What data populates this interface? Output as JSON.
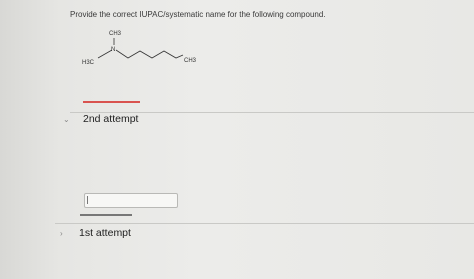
{
  "question": {
    "prompt": "Provide the correct IUPAC/systematic name for the following compound."
  },
  "structure": {
    "label_top_methyl": "CH3",
    "label_nitrogen": "N",
    "label_left_methyl": "H3C",
    "label_chain_end": "CH3"
  },
  "attempts": [
    {
      "label": "2nd attempt",
      "expanded": true,
      "chevron_icon": "chevron-down-icon"
    },
    {
      "label": "1st attempt",
      "expanded": false,
      "chevron_icon": "chevron-right-icon"
    }
  ],
  "answer_input": {
    "value": "",
    "placeholder": ""
  },
  "colors": {
    "attempt_underline": "#d9534f",
    "input_underline": "#777777"
  }
}
